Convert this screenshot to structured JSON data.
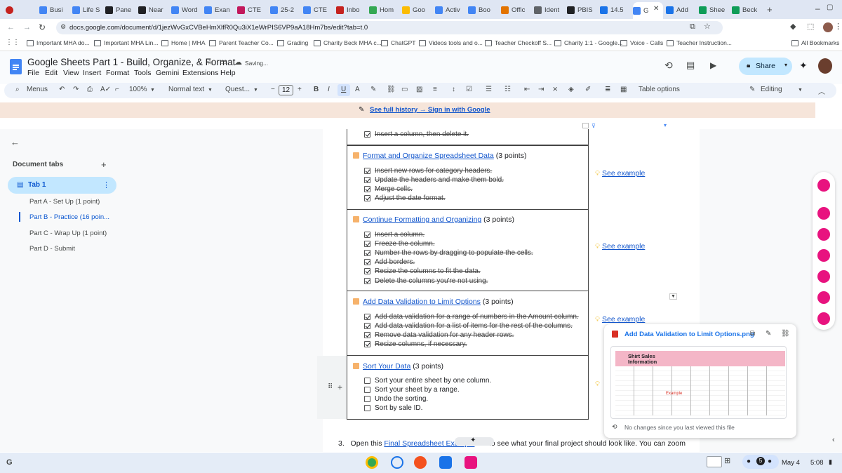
{
  "browser": {
    "tabs": [
      {
        "label": "Busi",
        "color": "#4285f4"
      },
      {
        "label": "Life S",
        "color": "#4285f4"
      },
      {
        "label": "Pane",
        "color": "#202124"
      },
      {
        "label": "Near",
        "color": "#202124"
      },
      {
        "label": "Word",
        "color": "#4285f4"
      },
      {
        "label": "Exan",
        "color": "#4285f4"
      },
      {
        "label": "CTE",
        "color": "#c2185b"
      },
      {
        "label": "25-2",
        "color": "#4285f4"
      },
      {
        "label": "CTE",
        "color": "#4285f4"
      },
      {
        "label": "Inbo",
        "color": "#c5221f"
      },
      {
        "label": "Hom",
        "color": "#34a853"
      },
      {
        "label": "Goo",
        "color": "#fbbc04"
      },
      {
        "label": "Activ",
        "color": "#4285f4"
      },
      {
        "label": "Boo",
        "color": "#4285f4"
      },
      {
        "label": "Offic",
        "color": "#e37400"
      },
      {
        "label": "Ident",
        "color": "#5f6368"
      },
      {
        "label": "PBIS",
        "color": "#202124"
      },
      {
        "label": "14.5",
        "color": "#1a73e8"
      },
      {
        "label": "G",
        "color": "#4285f4"
      },
      {
        "label": "Add",
        "color": "#1a73e8"
      },
      {
        "label": "Shee",
        "color": "#0f9d58"
      },
      {
        "label": "Beck",
        "color": "#0f9d58"
      }
    ],
    "url": "docs.google.com/document/d/1jezWvGxCVBeHmXlfR0Qu3iX1eWrPIS6VP9aA18Hm7bs/edit?tab=t.0",
    "bookmarks": [
      "Important MHA do...",
      "Important MHA Lin...",
      "Home | MHA",
      "Parent Teacher Co...",
      "Grading",
      "Charity Beck MHA c...",
      "ChatGPT",
      "Videos tools and o...",
      "Teacher Checkoff S...",
      "Charity 1:1 - Google...",
      "Voice - Calls",
      "Teacher Instruction..."
    ],
    "all_bookmarks": "All Bookmarks"
  },
  "doc": {
    "title": "Google Sheets Part 1 - Build, Organize, & Format",
    "saving": "Saving...",
    "menus": [
      "File",
      "Edit",
      "View",
      "Insert",
      "Format",
      "Tools",
      "Gemini",
      "Extensions",
      "Help"
    ],
    "share_label": "Share",
    "toolbar": {
      "menus_label": "Menus",
      "zoom": "100%",
      "style": "Normal text",
      "font": "Quest...",
      "font_size": "12",
      "table_options": "Table options",
      "mode": "Editing"
    },
    "banner": "See full history → Sign in with Google"
  },
  "sidebar": {
    "title": "Document tabs",
    "tab1": "Tab 1",
    "outline": [
      "Part A - Set Up (1 point)",
      "Part B - Practice (16 poin...",
      "Part C - Wrap Up (1 point)",
      "Part D - Submit"
    ]
  },
  "table": {
    "top_item": "Insert a column, then delete it.",
    "sections": [
      {
        "link": "Format and Organize Spreadsheet Data",
        "points": " (3 points)",
        "items": [
          "Insert new rows for category headers.",
          "Update the headers and make them bold.",
          "Merge cells.",
          "Adjust the date format."
        ],
        "example": "See example"
      },
      {
        "link": "Continue Formatting and Organizing",
        "points": " (3 points)",
        "items": [
          "Insert a column.",
          "Freeze the column.",
          "Number the rows by dragging to populate the cells.",
          "Add borders.",
          "Resize the columns to fit the data.",
          "Delete the columns you're not using."
        ],
        "example": "See example"
      },
      {
        "link": "Add Data Validation to Limit Options",
        "points": " (3 points)",
        "items": [
          "Add data validation for a range of numbers in the Amount column.",
          "Add data validation for a list of items for the rest of the columns.",
          "Remove data validation for any header rows.",
          "Resize columns, if necessary."
        ],
        "example": "See example"
      },
      {
        "link": "Sort Your Data",
        "points": " (3 points)",
        "items": [
          "Sort your entire sheet by one column.",
          "Sort your sheet by a range.",
          "Undo the sorting.",
          "Sort by sale ID."
        ]
      }
    ]
  },
  "footer_text": {
    "number": "3.",
    "before": "Open this ",
    "link": "Final Spreadsheet Example",
    "after": " tab to see what your final project should look like. You can zoom"
  },
  "popup": {
    "filename": "Add Data Validation to Limit Options.png",
    "thumb_title": "Shirt Sales Information",
    "thumb_label": "Example",
    "status": "No changes since you last viewed this file"
  },
  "shelf": {
    "date": "May 4",
    "time": "5:08",
    "notif_count": "5"
  }
}
